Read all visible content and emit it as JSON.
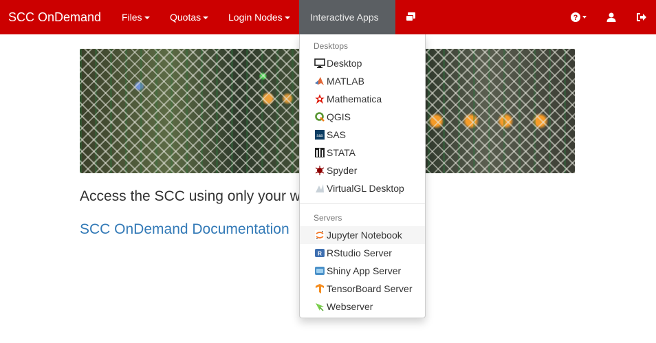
{
  "navbar": {
    "brand": "SCC OnDemand",
    "items": [
      {
        "label": "Files"
      },
      {
        "label": "Quotas"
      },
      {
        "label": "Login Nodes"
      },
      {
        "label": "Interactive Apps"
      }
    ],
    "icons": [
      "windows-icon",
      "help-icon",
      "user-icon",
      "sign-out-icon"
    ],
    "colors": {
      "background": "#cc0000",
      "active": "#5b5f63"
    }
  },
  "main": {
    "lead_text": "Access the SCC using only your w",
    "doc_link": "SCC OnDemand Documentation"
  },
  "dropdown": {
    "sections": [
      {
        "header": "Desktops",
        "items": [
          {
            "label": "Desktop",
            "icon": "monitor-icon"
          },
          {
            "label": "MATLAB",
            "icon": "matlab-icon"
          },
          {
            "label": "Mathematica",
            "icon": "mathematica-icon"
          },
          {
            "label": "QGIS",
            "icon": "qgis-icon"
          },
          {
            "label": "SAS",
            "icon": "sas-icon"
          },
          {
            "label": "STATA",
            "icon": "stata-icon"
          },
          {
            "label": "Spyder",
            "icon": "spyder-icon"
          },
          {
            "label": "VirtualGL Desktop",
            "icon": "virtualgl-icon"
          }
        ]
      },
      {
        "header": "Servers",
        "items": [
          {
            "label": "Jupyter Notebook",
            "icon": "jupyter-icon"
          },
          {
            "label": "RStudio Server",
            "icon": "rstudio-icon"
          },
          {
            "label": "Shiny App Server",
            "icon": "shiny-icon"
          },
          {
            "label": "TensorBoard Server",
            "icon": "tensorboard-icon"
          },
          {
            "label": "Webserver",
            "icon": "webserver-icon"
          }
        ]
      }
    ]
  }
}
